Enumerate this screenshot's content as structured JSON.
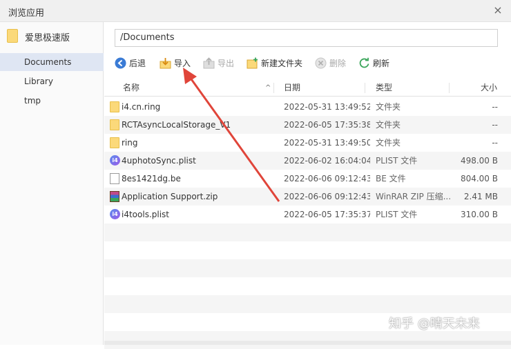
{
  "window": {
    "title": "浏览应用",
    "close_icon": "×"
  },
  "sidebar": {
    "app_name": "爱思极速版",
    "items": [
      {
        "label": "Documents",
        "active": true
      },
      {
        "label": "Library",
        "active": false
      },
      {
        "label": "tmp",
        "active": false
      }
    ]
  },
  "path": {
    "value": "/Documents"
  },
  "toolbar": {
    "back": "后退",
    "import": "导入",
    "export": "导出",
    "new_folder": "新建文件夹",
    "delete": "删除",
    "refresh": "刷新"
  },
  "table": {
    "headers": {
      "name": "名称",
      "date": "日期",
      "type": "类型",
      "size": "大小"
    },
    "rows": [
      {
        "icon": "folder-icon",
        "name": "i4.cn.ring",
        "date": "2022-05-31 13:49:52",
        "type": "文件夹",
        "size": "--"
      },
      {
        "icon": "folder-icon",
        "name": "RCTAsyncLocalStorage_V1",
        "date": "2022-06-05 17:35:38",
        "type": "文件夹",
        "size": "--"
      },
      {
        "icon": "folder-icon",
        "name": "ring",
        "date": "2022-05-31 13:49:50",
        "type": "文件夹",
        "size": "--"
      },
      {
        "icon": "plist-icon",
        "name": "4uphotoSync.plist",
        "date": "2022-06-02 16:04:04",
        "type": "PLIST 文件",
        "size": "498.00 B"
      },
      {
        "icon": "file-icon",
        "name": "8es1421dg.be",
        "date": "2022-06-06 09:12:43",
        "type": "BE 文件",
        "size": "804.00 B"
      },
      {
        "icon": "zip-icon",
        "name": "Application Support.zip",
        "date": "2022-06-06 09:12:43",
        "type": "WinRAR ZIP 压缩...",
        "size": "2.41 MB"
      },
      {
        "icon": "plist-icon",
        "name": "i4tools.plist",
        "date": "2022-06-05 17:35:37",
        "type": "PLIST 文件",
        "size": "310.00 B"
      }
    ]
  },
  "watermark": "知乎 @晴天未来",
  "colors": {
    "accent": "#3a7bd5",
    "arrow": "#e0453a",
    "selected": "#dfe6f3",
    "folder": "#fbd97a"
  }
}
